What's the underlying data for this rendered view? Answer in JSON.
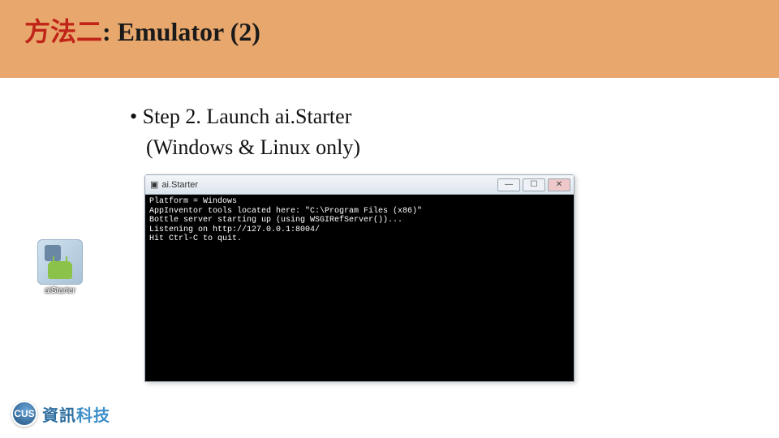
{
  "slide": {
    "title_zh": "方法二",
    "title_sep": ": ",
    "title_en": "Emulator (2)",
    "bullet": "• Step 2. Launch ai.Starter",
    "bullet_sub": "(Windows & Linux only)"
  },
  "desktop_icon": {
    "label": "aiStarter"
  },
  "cmd": {
    "title": "ai.Starter",
    "buttons": {
      "min": "—",
      "max": "☐",
      "close": "✕"
    },
    "lines": [
      "Platform = Windows",
      "AppInventor tools located here: \"C:\\Program Files (x86)\"",
      "Bottle server starting up (using WSGIRefServer())...",
      "Listening on http://127.0.0.1:8004/",
      "Hit Ctrl-C to quit."
    ]
  },
  "footer": {
    "badge": "CUS",
    "text": [
      "資",
      "訊",
      "科",
      "技"
    ]
  }
}
